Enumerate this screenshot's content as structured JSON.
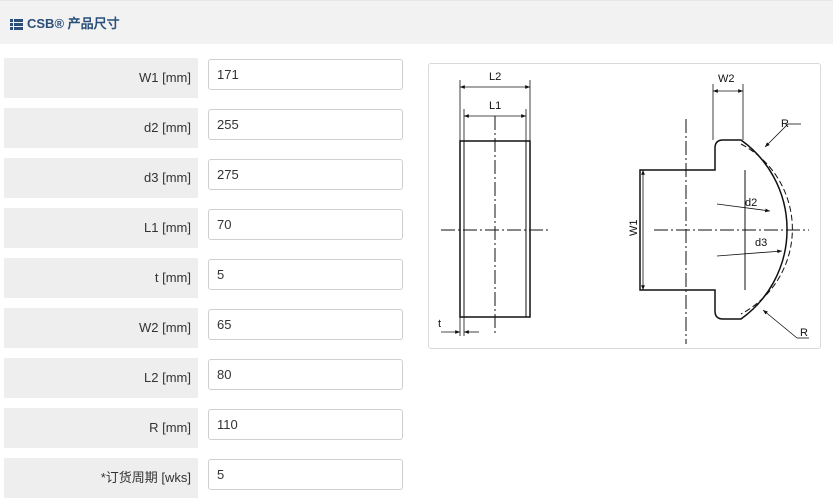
{
  "header": {
    "title": "CSB® 产品尺寸",
    "icon": "list-icon"
  },
  "fields": [
    {
      "label": "W1 [mm]",
      "value": "171"
    },
    {
      "label": "d2 [mm]",
      "value": "255"
    },
    {
      "label": "d3 [mm]",
      "value": "275"
    },
    {
      "label": "L1 [mm]",
      "value": "70"
    },
    {
      "label": "t [mm]",
      "value": "5"
    },
    {
      "label": "W2 [mm]",
      "value": "65"
    },
    {
      "label": "L2 [mm]",
      "value": "80"
    },
    {
      "label": "R [mm]",
      "value": "110"
    },
    {
      "label": "*订货周期 [wks]",
      "value": "5"
    }
  ],
  "diagram": {
    "labels": {
      "l2": "L2",
      "l1": "L1",
      "t": "t",
      "w2": "W2",
      "r_top": "R",
      "r_bottom": "R",
      "w1": "W1",
      "d2": "d2",
      "d3": "d3"
    }
  }
}
